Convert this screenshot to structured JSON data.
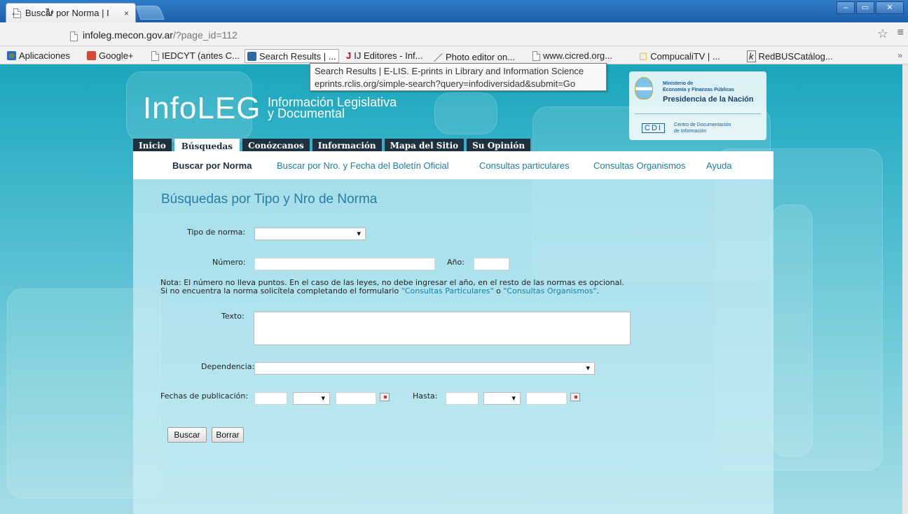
{
  "browser": {
    "tab_title": "Buscar por Norma | I",
    "tab_close": "×",
    "url_domain": "infoleg.mecon.gov.ar",
    "url_path": "/?page_id=112",
    "bookmarks": [
      {
        "label": "Aplicaciones",
        "icon": "apps-grid-icon"
      },
      {
        "label": "Google+",
        "icon": "google-plus-icon"
      },
      {
        "label": "IEDCYT (antes C...",
        "icon": "page-icon"
      },
      {
        "label": "Search Results | ...",
        "icon": "eprints-icon"
      },
      {
        "label": "IJ Editores - Inf...",
        "icon": "ij-icon"
      },
      {
        "label": "Photo editor on...",
        "icon": "brush-icon"
      },
      {
        "label": "www.cicred.org...",
        "icon": "page-icon"
      },
      {
        "label": "CompucaliTV | ...",
        "icon": "tv-icon"
      },
      {
        "label": "RedBUSCatálog...",
        "icon": "k-icon"
      }
    ],
    "tooltip_title": "Search Results | E-LIS. E-prints in Library and Information Science",
    "tooltip_url": "eprints.rclis.org/simple-search?query=infodiversidad&submit=Go"
  },
  "site": {
    "logo": "InfoLEG",
    "logo_sub1": "Información Legislativa",
    "logo_sub2": "y Documental",
    "ministry_line1": "Ministerio de",
    "ministry_line2": "Economía y Finanzas Públicas",
    "ministry_line3": "Presidencia de la Nación",
    "cdi": "CDI",
    "cdi_line1": "Centro de Documentación",
    "cdi_line2": "de Información"
  },
  "main_nav": [
    "Inicio",
    "Búsquedas",
    "Conózcanos",
    "Información",
    "Mapa del Sitio",
    "Su Opinión"
  ],
  "sub_nav": [
    "Buscar por Norma",
    "Buscar por Nro. y Fecha del Boletín Oficial",
    "Consultas particulares",
    "Consultas Organismos",
    "Ayuda"
  ],
  "form": {
    "heading": "Búsquedas por Tipo y Nro de Norma",
    "tipo_label": "Tipo de norma:",
    "numero_label": "Número:",
    "anio_label": "Año:",
    "note_line1": "Nota: El número no lleva puntos. En el caso de las leyes, no debe ingresar el año, en el resto de las normas es opcional.",
    "note_line2_a": "Si no encuentra la norma solicítela completando el formulario ",
    "note_link1": "\"Consultas Particulares\"",
    "note_mid": " o ",
    "note_link2": "\"Consultas Organismos\"",
    "note_end": ".",
    "texto_label": "Texto:",
    "dependencia_label": "Dependencia:",
    "fechas_label": "Fechas de publicación:",
    "hasta_label": "Hasta:",
    "buscar": "Buscar",
    "borrar": "Borrar"
  }
}
